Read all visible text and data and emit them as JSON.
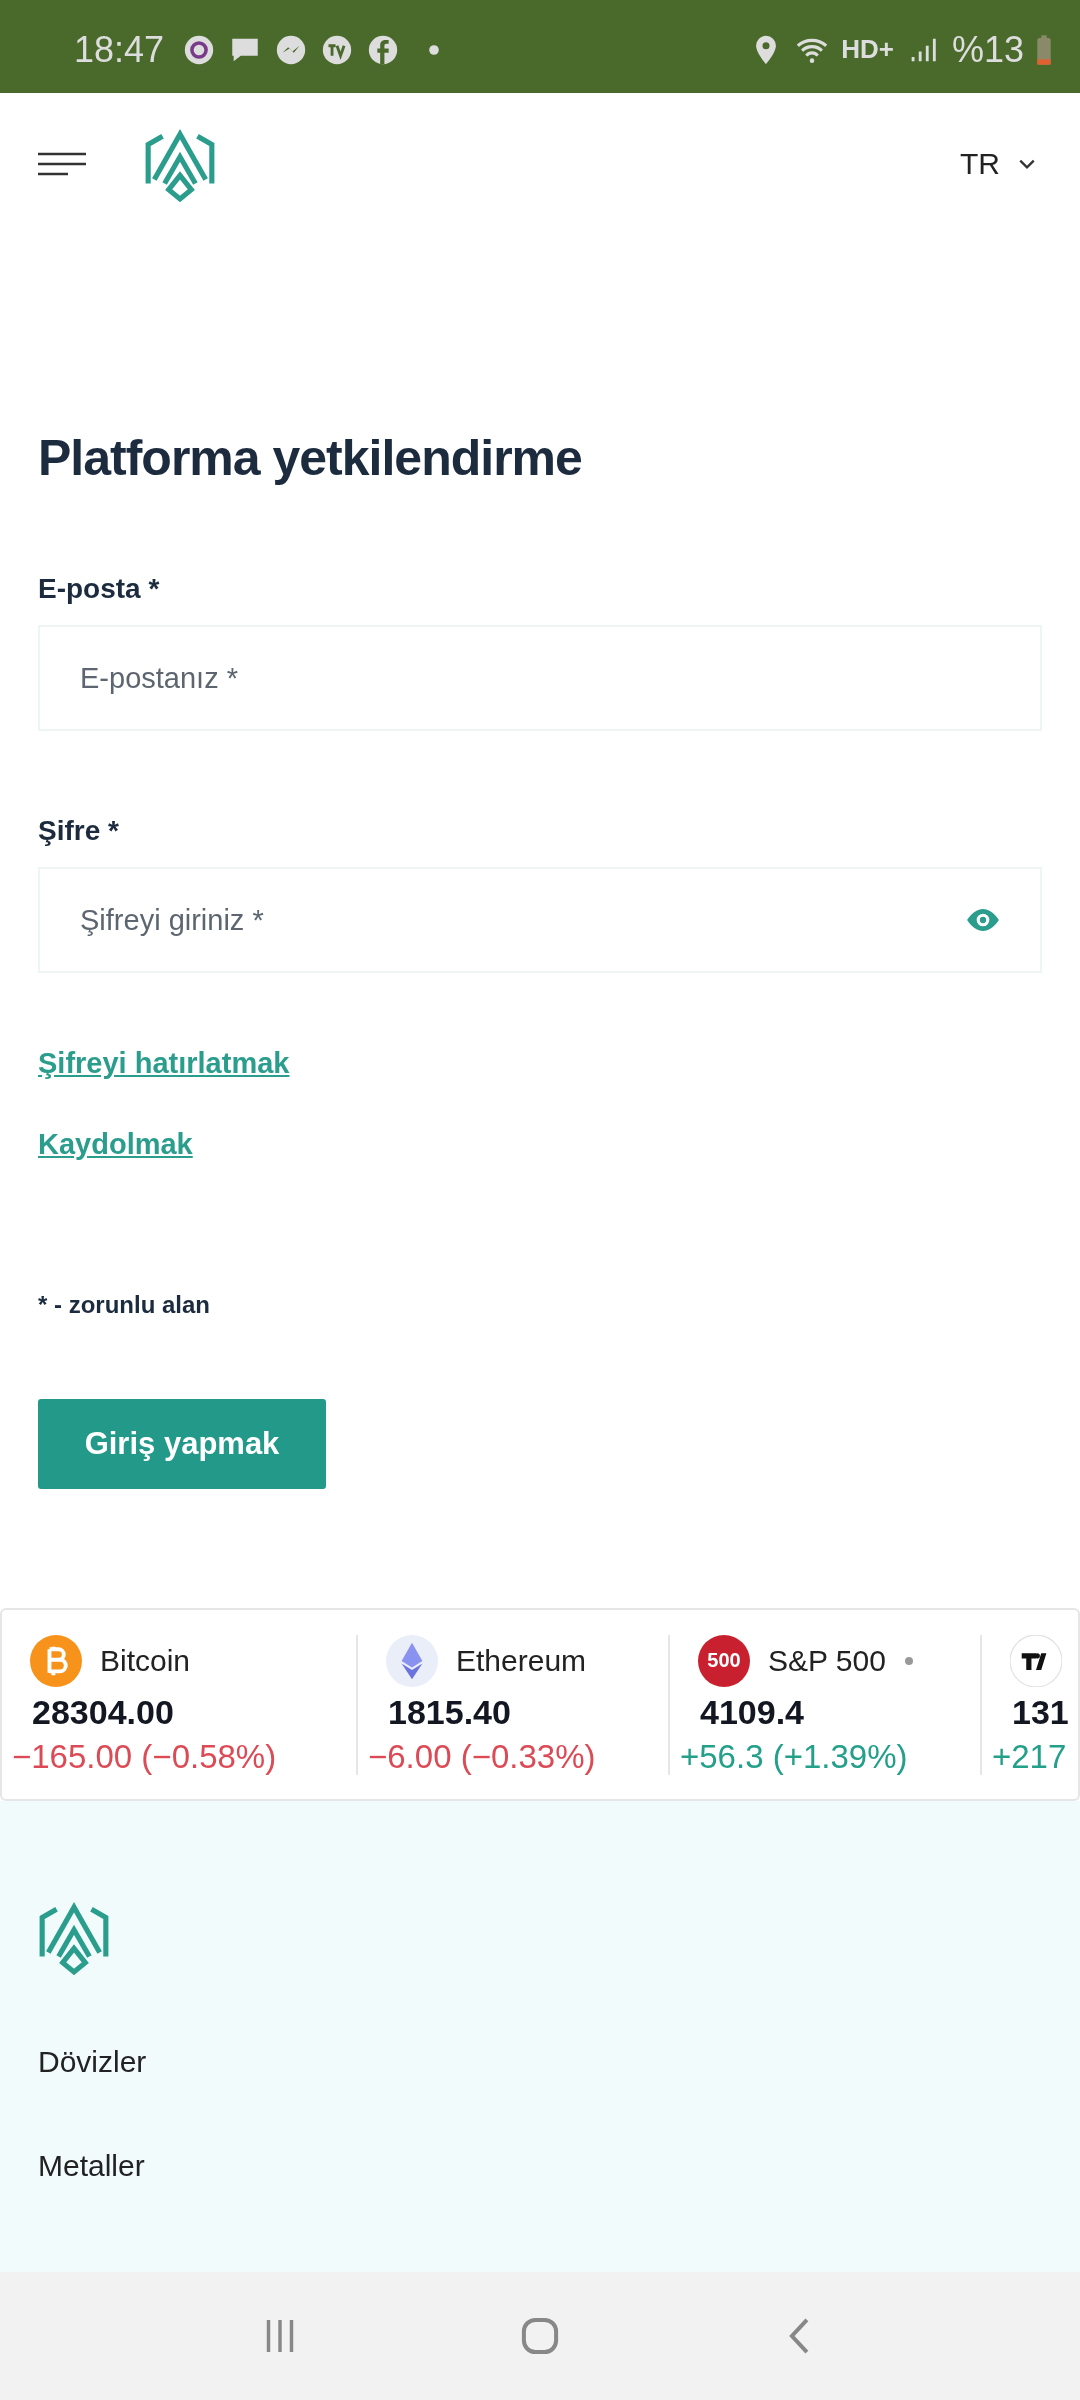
{
  "status_bar": {
    "time": "18:47",
    "network": "HD+",
    "battery": "%13"
  },
  "header": {
    "language": "TR"
  },
  "title": "Platforma yetkilendirme",
  "fields": [
    {
      "label": "E-posta *",
      "placeholder": "E-postanız *",
      "kind": "text"
    },
    {
      "label": "Şifre *",
      "placeholder": "Şifreyi giriniz *",
      "kind": "password"
    }
  ],
  "links": [
    "Şifreyi hatırlatmak",
    "Kaydolmak"
  ],
  "note": "* - zorunlu alan",
  "submit": "Giriş yapmak",
  "ticker": [
    {
      "name": "Bitcoin",
      "price": "28304.00",
      "change": "−165.00 (−0.58%)",
      "kind": "down"
    },
    {
      "name": "Ethereum",
      "price": "1815.40",
      "change": "−6.00 (−0.33%)",
      "kind": "down"
    },
    {
      "name": "S&P 500",
      "price": "4109.4",
      "change": "+56.3 (+1.39%)",
      "kind": "up",
      "badge": "500"
    },
    {
      "price": "131",
      "change": "+217",
      "kind": "up"
    }
  ],
  "footer": {
    "menu": [
      "Dövizler",
      "Metaller"
    ]
  }
}
